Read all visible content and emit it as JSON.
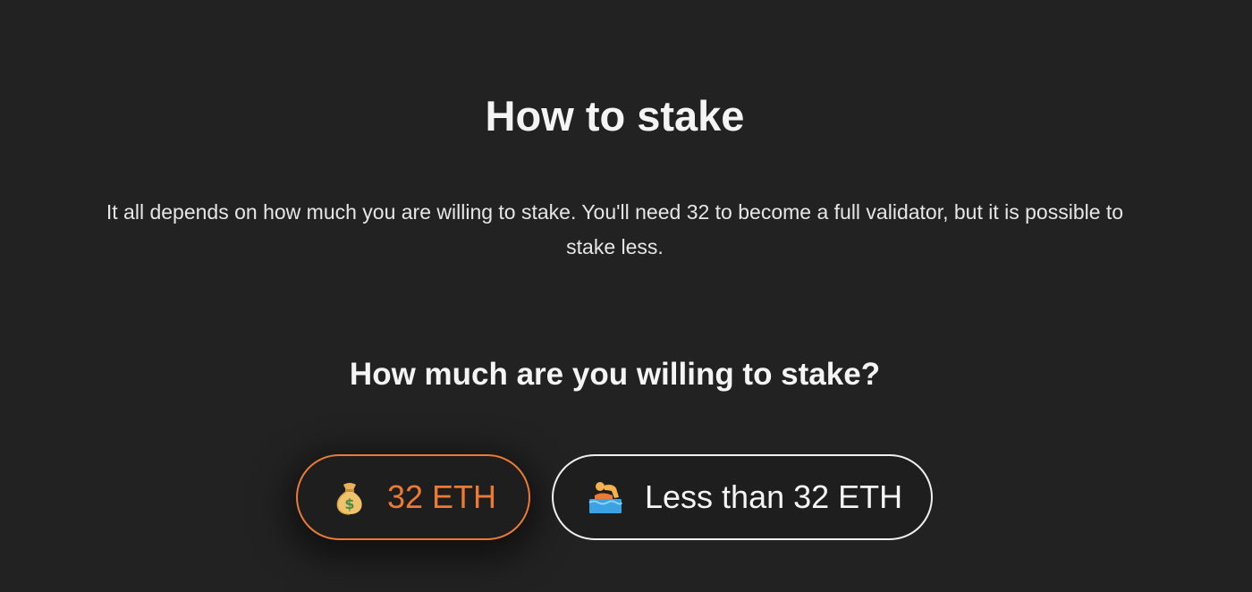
{
  "section": {
    "title": "How to stake",
    "description": "It all depends on how much you are willing to stake. You'll need 32 to become a full validator, but it is possible to stake less.",
    "question": "How much are you willing to stake?"
  },
  "options": [
    {
      "label": "32 ETH",
      "icon": "money-bag-icon",
      "selected": true
    },
    {
      "label": "Less than 32 ETH",
      "icon": "swimmer-icon",
      "selected": false
    }
  ],
  "colors": {
    "background": "#222222",
    "accent": "#ea7a35",
    "text": "#f4f4f4"
  }
}
